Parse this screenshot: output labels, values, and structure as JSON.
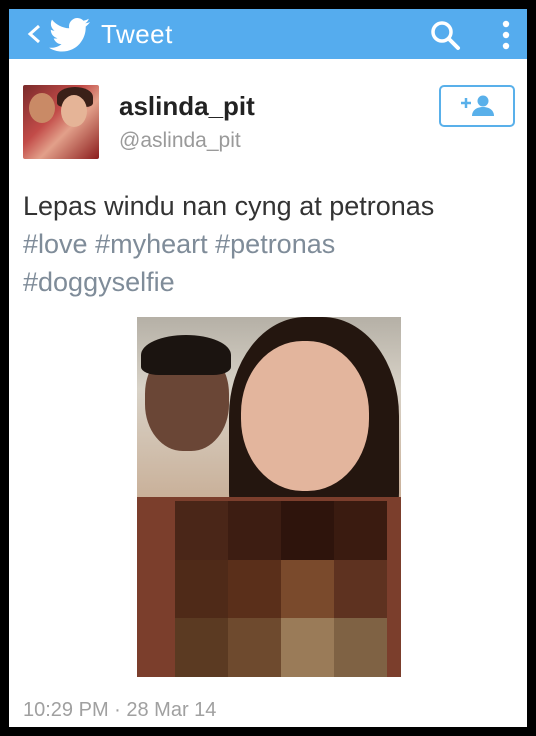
{
  "app_bar": {
    "title": "Tweet",
    "back_icon": "chevron-left-icon",
    "logo_icon": "twitter-bird-icon",
    "search_icon": "search-icon",
    "menu_icon": "overflow-menu-icon",
    "color": "#55acee"
  },
  "tweet": {
    "display_name": "aslinda_pit",
    "handle": "@aslinda_pit",
    "follow_icon": "add-user-icon",
    "text_plain": "Lepas windu nan cyng at petronas",
    "hashtags": [
      "#love",
      "#myheart",
      "#petronas",
      "#doggyselfie"
    ],
    "timestamp": "10:29 PM · 28 Mar 14",
    "hashtag_color": "#7f8c99",
    "follow_border_color": "#59b0ea"
  }
}
